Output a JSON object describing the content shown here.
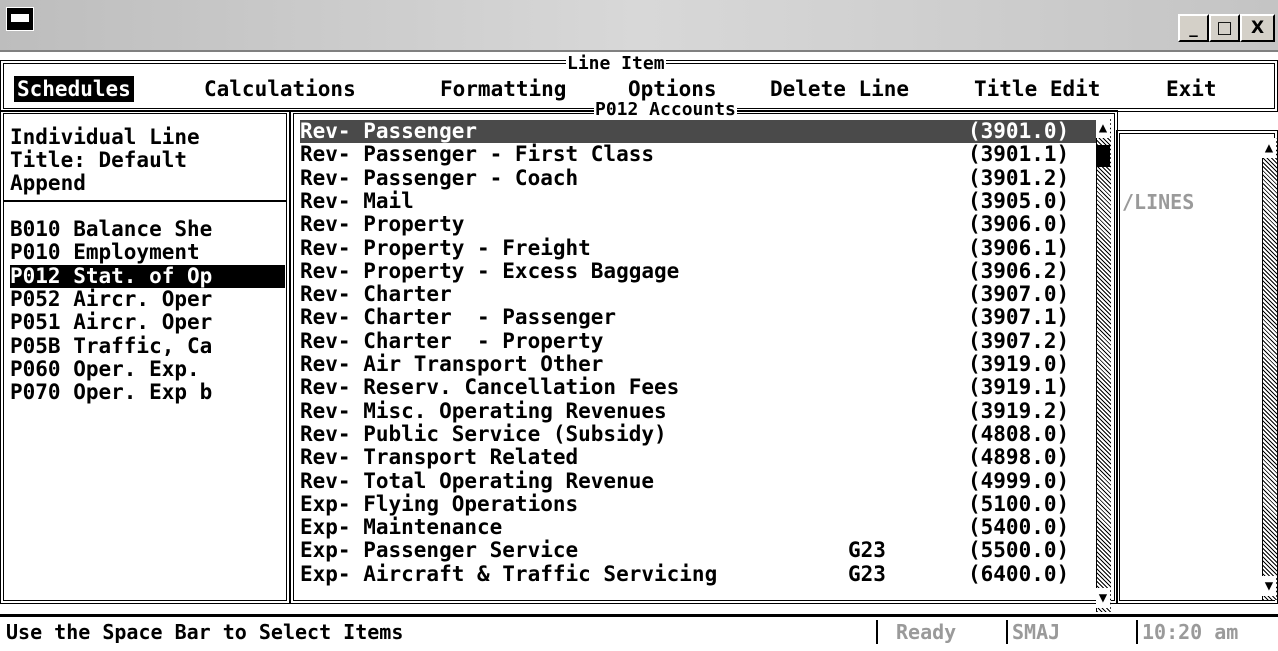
{
  "window": {
    "minimize": "_",
    "maximize": "□",
    "close": "X"
  },
  "menu": {
    "frame_caption": "Line Item",
    "items": [
      "Schedules",
      "Calculations",
      "Formatting",
      "Options",
      "Delete Line",
      "Title Edit",
      "Exit"
    ]
  },
  "left_panel": {
    "header": [
      "Individual Line",
      "Title: Default",
      "Append"
    ],
    "schedules": [
      "B010 Balance She",
      "P010 Employment",
      "P012 Stat. of Op",
      "P052 Aircr. Oper",
      "P051 Aircr. Oper",
      "P05B Traffic, Ca",
      "P060 Oper. Exp.",
      "P070 Oper. Exp b"
    ],
    "selected_index": 2
  },
  "list": {
    "caption": "P012 Accounts",
    "selected_index": 0,
    "rows": [
      {
        "desc": "Rev- Passenger",
        "group": "",
        "code": "(3901.0)"
      },
      {
        "desc": "Rev- Passenger - First Class",
        "group": "",
        "code": "(3901.1)"
      },
      {
        "desc": "Rev- Passenger - Coach",
        "group": "",
        "code": "(3901.2)"
      },
      {
        "desc": "Rev- Mail",
        "group": "",
        "code": "(3905.0)"
      },
      {
        "desc": "Rev- Property",
        "group": "",
        "code": "(3906.0)"
      },
      {
        "desc": "Rev- Property - Freight",
        "group": "",
        "code": "(3906.1)"
      },
      {
        "desc": "Rev- Property - Excess Baggage",
        "group": "",
        "code": "(3906.2)"
      },
      {
        "desc": "Rev- Charter",
        "group": "",
        "code": "(3907.0)"
      },
      {
        "desc": "Rev- Charter  - Passenger",
        "group": "",
        "code": "(3907.1)"
      },
      {
        "desc": "Rev- Charter  - Property",
        "group": "",
        "code": "(3907.2)"
      },
      {
        "desc": "Rev- Air Transport Other",
        "group": "",
        "code": "(3919.0)"
      },
      {
        "desc": "Rev- Reserv. Cancellation Fees",
        "group": "",
        "code": "(3919.1)"
      },
      {
        "desc": "Rev- Misc. Operating Revenues",
        "group": "",
        "code": "(3919.2)"
      },
      {
        "desc": "Rev- Public Service (Subsidy)",
        "group": "",
        "code": "(4808.0)"
      },
      {
        "desc": "Rev- Transport Related",
        "group": "",
        "code": "(4898.0)"
      },
      {
        "desc": "Rev- Total Operating Revenue",
        "group": "",
        "code": "(4999.0)"
      },
      {
        "desc": "Exp- Flying Operations",
        "group": "",
        "code": "(5100.0)"
      },
      {
        "desc": "Exp- Maintenance",
        "group": "",
        "code": "(5400.0)"
      },
      {
        "desc": "Exp- Passenger Service",
        "group": "G23",
        "code": "(5500.0)"
      },
      {
        "desc": "Exp- Aircraft & Traffic Servicing",
        "group": "G23",
        "code": "(6400.0)"
      }
    ]
  },
  "right_panel": {
    "label": "LINES"
  },
  "status": {
    "hint": "Use the Space Bar to Select Items",
    "state": "Ready",
    "user": "SMAJ",
    "time": "10:20 am"
  }
}
